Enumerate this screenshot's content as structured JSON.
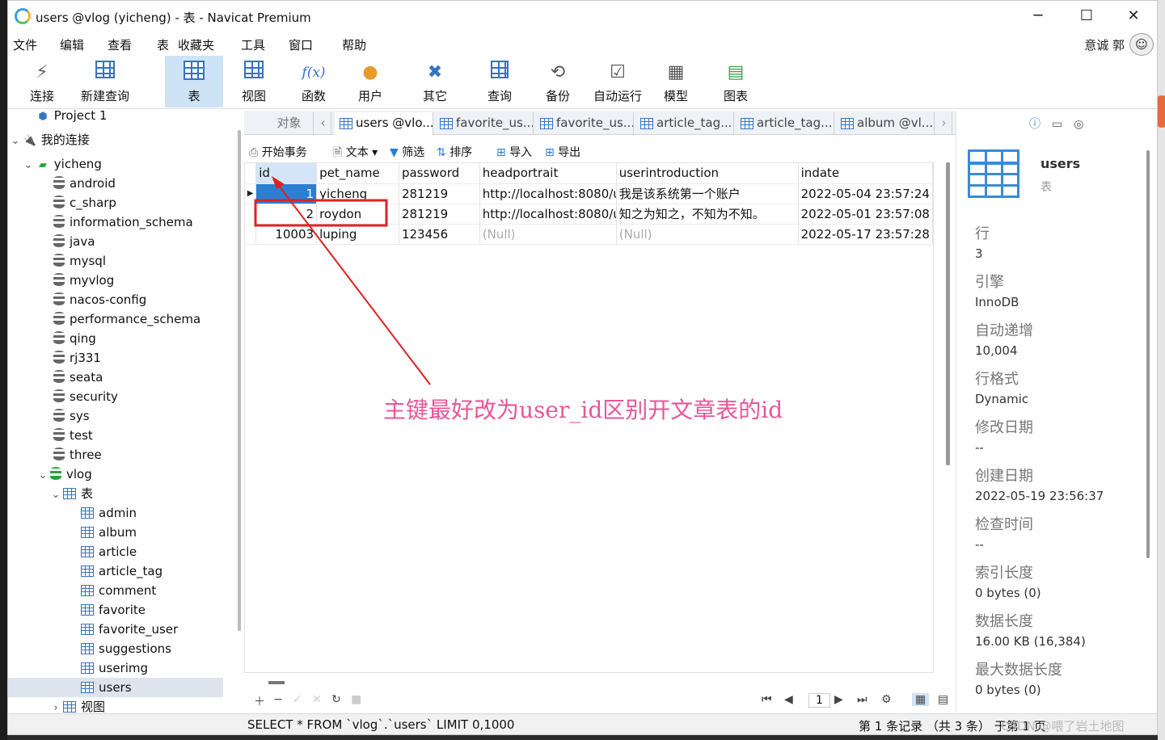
{
  "window": {
    "title": "users @vlog (yicheng) - 表 - Navicat Premium",
    "minimize": "─",
    "maximize": "☐",
    "close": "✕"
  },
  "menu": [
    "文件",
    "编辑",
    "查看",
    "表",
    "收藏夹",
    "工具",
    "窗口",
    "帮助"
  ],
  "user": {
    "name": "意诚 郭",
    "avatar": "☺"
  },
  "toolbar": [
    {
      "label": "连接",
      "icon": "plug-icon"
    },
    {
      "label": "新建查询",
      "icon": "new-query-icon"
    },
    {
      "label": "表",
      "icon": "table-icon"
    },
    {
      "label": "视图",
      "icon": "view-icon"
    },
    {
      "label": "函数",
      "icon": "function-icon",
      "glyph": "f(x)"
    },
    {
      "label": "用户",
      "icon": "user-icon"
    },
    {
      "label": "其它",
      "icon": "tools-icon"
    },
    {
      "label": "查询",
      "icon": "query-icon"
    },
    {
      "label": "备份",
      "icon": "backup-icon"
    },
    {
      "label": "自动运行",
      "icon": "schedule-icon"
    },
    {
      "label": "模型",
      "icon": "model-icon"
    },
    {
      "label": "图表",
      "icon": "chart-icon"
    }
  ],
  "tree": {
    "project": "Project 1",
    "connections_label": "我的连接",
    "connection": "yicheng",
    "databases": [
      "android",
      "c_sharp",
      "information_schema",
      "java",
      "mysql",
      "myvlog",
      "nacos-config",
      "performance_schema",
      "qing",
      "rj331",
      "seata",
      "security",
      "sys",
      "test",
      "three"
    ],
    "open_db": "vlog",
    "tables_label": "表",
    "tables": [
      "admin",
      "album",
      "article",
      "article_tag",
      "comment",
      "favorite",
      "favorite_user",
      "suggestions",
      "userimg",
      "users"
    ],
    "views_label": "视图"
  },
  "tabs": {
    "objects": "对象",
    "items": [
      "users @vlo...",
      "favorite_us...",
      "favorite_us...",
      "article_tag...",
      "article_tag...",
      "album @vl..."
    ]
  },
  "data_toolbar": {
    "begin_tx": "开始事务",
    "text": "文本",
    "filter": "筛选",
    "sort": "排序",
    "import": "导入",
    "export": "导出"
  },
  "grid": {
    "columns": [
      "id",
      "pet_name",
      "password",
      "headportrait",
      "userintroduction",
      "indate"
    ],
    "rows": [
      [
        "1",
        "yicheng",
        "281219",
        "http://localhost:8080/u",
        "我是该系统第一个账户",
        "2022-05-04 23:57:24"
      ],
      [
        "2",
        "roydon",
        "281219",
        "http://localhost:8080/u",
        "知之为知之，不知为不知。",
        "2022-05-01 23:57:08"
      ],
      [
        "10003",
        "luping",
        "123456",
        "(Null)",
        "(Null)",
        "2022-05-17 23:57:28"
      ]
    ]
  },
  "bottom_nav": {
    "page": "1"
  },
  "status": {
    "sql": "SELECT * FROM `vlog`.`users` LIMIT 0,1000",
    "records": "第 1 条记录 （共 3 条） 于第 1 页",
    "watermark": "CSDN @喂了岩土地图"
  },
  "info": {
    "name": "users",
    "type": "表",
    "props": [
      {
        "k": "行",
        "v": "3"
      },
      {
        "k": "引擎",
        "v": "InnoDB"
      },
      {
        "k": "自动递增",
        "v": "10,004"
      },
      {
        "k": "行格式",
        "v": "Dynamic"
      },
      {
        "k": "修改日期",
        "v": "--"
      },
      {
        "k": "创建日期",
        "v": "2022-05-19 23:56:37"
      },
      {
        "k": "检查时间",
        "v": "--"
      },
      {
        "k": "索引长度",
        "v": "0 bytes (0)"
      },
      {
        "k": "数据长度",
        "v": "16.00 KB (16,384)"
      },
      {
        "k": "最大数据长度",
        "v": "0 bytes (0)"
      }
    ]
  },
  "annotation": {
    "text": "主键最好改为user_id区别开文章表的id",
    "color": "#e8559a",
    "arrow_color": "#e02020"
  },
  "colors": {
    "accent": "#3474c4",
    "selection": "#2a7fd4",
    "active_tool": "#cfe3f7"
  }
}
